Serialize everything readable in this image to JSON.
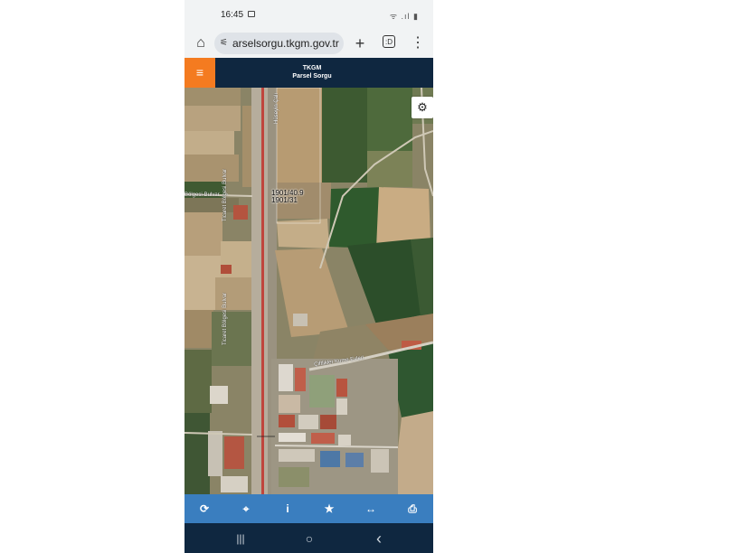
{
  "status_bar": {
    "time": "16:45",
    "icons": "ᯤ .ıl ▮"
  },
  "browser": {
    "home_icon": "⌂",
    "url": "arselsorgu.tkgm.gov.tr",
    "url_prefix_icon": "⚟",
    "new_tab_icon": "+",
    "tabs_count": ":D",
    "menu_icon": "⋮"
  },
  "app": {
    "menu_icon": "≡",
    "title_line1": "TKGM",
    "title_line2": "Parsel Sorgu"
  },
  "map": {
    "settings_icon": "⚙",
    "parcel_label_1": "1901/40.9",
    "parcel_label_2": "1901/31",
    "road_labels": [
      "Bölgesi-Bulvar",
      "Ticaret Bölgesi Bulvar",
      "Ticaret Bölgesi Bulvar",
      "Çiftlikler Kume Evleri",
      "Hüseyin Çalı"
    ]
  },
  "toolbar": {
    "refresh_icon": "⟳",
    "locate_icon": "⌖",
    "info_icon": "i",
    "favorite_icon": "★",
    "measure_icon": "↔",
    "print_icon": "⎙"
  },
  "nav": {
    "recents": "|||",
    "home": "○",
    "back": "‹"
  },
  "colors": {
    "header": "#0f2740",
    "accent": "#f47b20",
    "toolbar": "#3a7ebf"
  }
}
